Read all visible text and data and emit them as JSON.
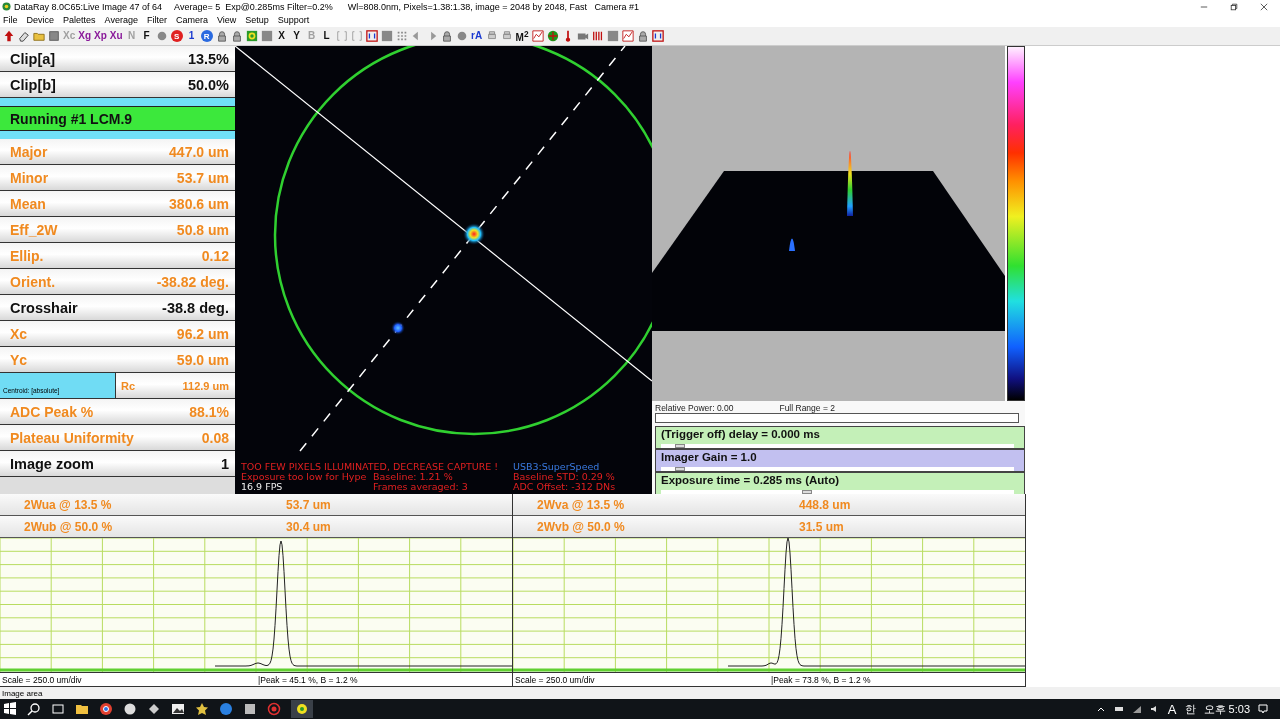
{
  "window": {
    "title": "DataRay 8.0C65:Live Image 47 of 64     Average= 5  Exp@0.285ms Filter=0.2%      Wl=808.0nm, Pixels=1.38:1.38, image = 2048 by 2048, Fast   Camera #1"
  },
  "menu": [
    "File",
    "Device",
    "Palettes",
    "Average",
    "Filter",
    "Camera",
    "View",
    "Setup",
    "Support"
  ],
  "toolbar": [
    {
      "kind": "text",
      "label": "Xc",
      "color": "#a0a0a0"
    },
    {
      "kind": "text",
      "label": "Xg",
      "color": "#8a1a9a"
    },
    {
      "kind": "text",
      "label": "Xp",
      "color": "#8a1a9a"
    },
    {
      "kind": "text",
      "label": "Xu",
      "color": "#8a1a9a"
    },
    {
      "kind": "text",
      "label": "N",
      "color": "#a0a0a0"
    },
    {
      "kind": "text",
      "label": "F",
      "color": "#111111"
    },
    {
      "kind": "badge",
      "label": "S",
      "color": "#e02020"
    },
    {
      "kind": "text",
      "label": "1",
      "color": "#1a3ad0"
    },
    {
      "kind": "badge",
      "label": "R",
      "color": "#2a6ae0"
    },
    {
      "kind": "text",
      "label": "X",
      "color": "#111111"
    },
    {
      "kind": "text",
      "label": "Y",
      "color": "#111111"
    },
    {
      "kind": "text",
      "label": "B",
      "color": "#a0a0a0"
    },
    {
      "kind": "text",
      "label": "L",
      "color": "#111111"
    },
    {
      "kind": "text",
      "label": "rA",
      "color": "#1a3ad0"
    },
    {
      "kind": "text",
      "label": "M$^{2}$",
      "color": "#111111"
    }
  ],
  "panel": [
    {
      "kind": "setting",
      "label": "Clip[a]",
      "value": "13.5%"
    },
    {
      "kind": "setting",
      "label": "Clip[b]",
      "value": "50.0%"
    },
    {
      "kind": "status",
      "label": "Running #1 LCM.9"
    },
    {
      "kind": "result",
      "label": "Major",
      "value": "447.0 um"
    },
    {
      "kind": "result",
      "label": "Minor",
      "value": "53.7 um"
    },
    {
      "kind": "result",
      "label": "Mean",
      "value": "380.6 um"
    },
    {
      "kind": "result",
      "label": "Eff_2W",
      "value": "50.8 um"
    },
    {
      "kind": "result",
      "label": "Ellip.",
      "value": "0.12"
    },
    {
      "kind": "result",
      "label": "Orient.",
      "value": "-38.82 deg."
    },
    {
      "kind": "setting",
      "label": "Crosshair",
      "value": "-38.8 deg."
    },
    {
      "kind": "result",
      "label": "Xc",
      "value": "96.2 um"
    },
    {
      "kind": "result",
      "label": "Yc",
      "value": "59.0 um"
    },
    {
      "kind": "centroid",
      "label": "Centroid: [absolute]",
      "name": "Rc",
      "value": "112.9 um"
    },
    {
      "kind": "result",
      "label": "ADC Peak %",
      "value": "88.1%"
    },
    {
      "kind": "result",
      "label": "Plateau Uniformity",
      "value": "0.08"
    },
    {
      "kind": "setting",
      "label": "Image zoom",
      "value": "1"
    }
  ],
  "image_messages": {
    "warning": "TOO FEW PIXELS ILLUMINATED, DECREASE CAPTURE !",
    "usb": "USB3:SuperSpeed",
    "exposure": "Exposure too low for Hype",
    "baseline": "Baseline: 1.21 %",
    "baseline_std": "Baseline STD:  0.29 %",
    "fps": "16.9 FPS",
    "frames": "Frames averaged: 3",
    "adc_offset": "ADC Offset: -312 DNs"
  },
  "power": {
    "relative": "Relative Power: 0.00",
    "range": "Full Range = 2"
  },
  "sliders": [
    {
      "label": "(Trigger off) delay = 0.000 ms",
      "level": 0.04,
      "selected": false
    },
    {
      "label": "Imager Gain = 1.0",
      "level": 0.04,
      "selected": true
    },
    {
      "label": "Exposure time = 0.285 ms (Auto)",
      "level": 0.4,
      "selected": false
    }
  ],
  "profiles": [
    {
      "rows": [
        {
          "label": "2Wua @ 13.5 %",
          "value": "53.7 um"
        },
        {
          "label": "2Wub @ 50.0 %",
          "value": "30.4 um"
        }
      ],
      "scale": "Scale = 250.0 um/div",
      "peak": "|Peak = 45.1 %,  B = 1.2 %"
    },
    {
      "rows": [
        {
          "label": "2Wva @ 13.5 %",
          "value": "448.8 um"
        },
        {
          "label": "2Wvb @ 50.0 %",
          "value": "31.5 um"
        }
      ],
      "scale": "Scale = 250.0 um/div",
      "peak": "|Peak = 73.8 %,  B = 1.2 %"
    }
  ],
  "status_bar": "Image area",
  "taskbar": {
    "input": "A",
    "ime": "한",
    "clock": "오후 5:03"
  }
}
